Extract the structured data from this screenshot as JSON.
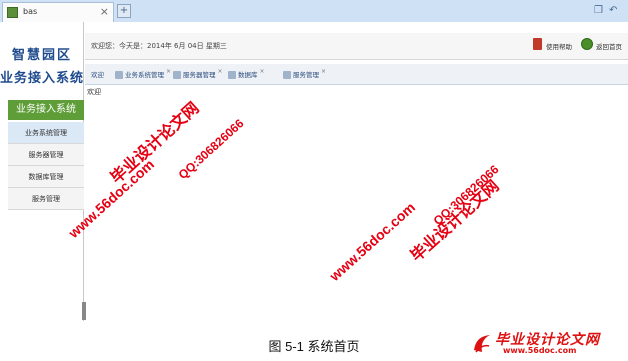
{
  "browser": {
    "tab_title": "bas",
    "tab_close": "×",
    "new_tab": "+"
  },
  "sidebar": {
    "brand_line1": "智慧园区",
    "brand_line2": "业务接入系统",
    "header": "业务接入系统",
    "items": [
      {
        "label": "业务系统管理",
        "active": true
      },
      {
        "label": "服务器管理",
        "active": false
      },
      {
        "label": "数据库管理",
        "active": false
      },
      {
        "label": "服务管理",
        "active": false
      }
    ]
  },
  "header": {
    "welcome": "欢迎您：今天是：2014年 6月 04日 星期三",
    "help_label": "使用帮助",
    "home_label": "返回首页"
  },
  "tabs": [
    {
      "label": "欢迎",
      "closable": false
    },
    {
      "label": "业务系统管理",
      "closable": true
    },
    {
      "label": "服务器管理",
      "closable": true
    },
    {
      "label": "数据库",
      "closable": true
    },
    {
      "label": "服务管理",
      "closable": true
    }
  ],
  "content": {
    "welcome_text": "欢迎"
  },
  "watermarks": {
    "site_name": "毕业设计论文网",
    "qq": "QQ:306826066",
    "url": "www.56doc.com"
  },
  "caption": "图 5-1 系统首页",
  "logo": {
    "name": "毕业设计论文网",
    "url": "www.56doc.com"
  },
  "colors": {
    "watermark": "#e60012",
    "sidebar_header": "#5e9d37",
    "brand": "#1f4c8e"
  }
}
